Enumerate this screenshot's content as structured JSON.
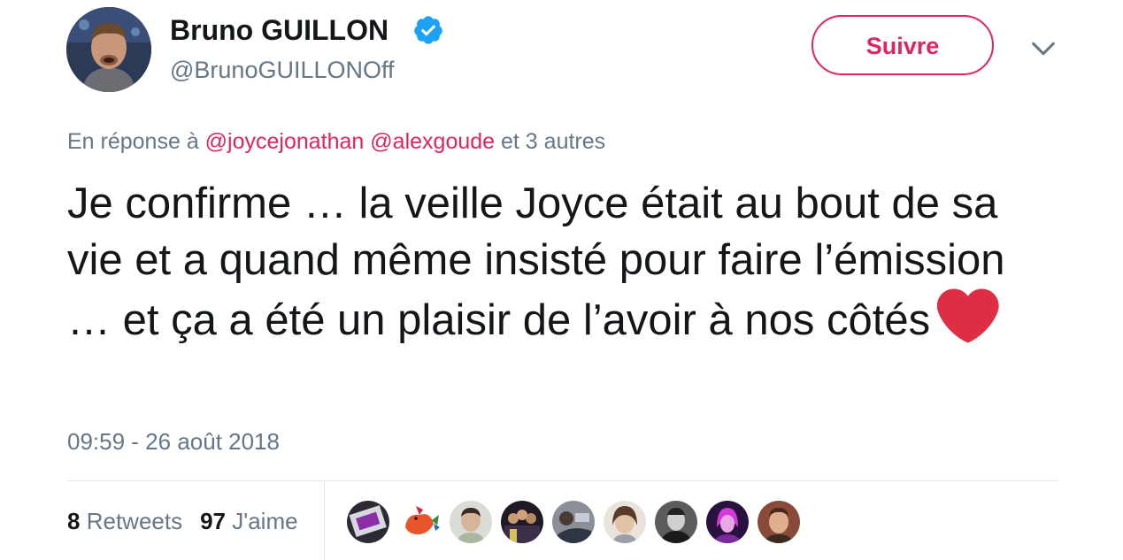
{
  "tweet": {
    "author": {
      "name": "Bruno GUILLON",
      "handle": "@BrunoGUILLONOff",
      "avatar_icon": "profile-photo",
      "verified_icon": "verified-badge-icon"
    },
    "follow_button_label": "Suivre",
    "menu_icon": "chevron-down-icon",
    "reply_context": {
      "prefix": "En réponse à",
      "mentions": [
        "@joycejonathan",
        "@alexgoude"
      ],
      "suffix": "et 3 autres"
    },
    "text": "Je confirme … la veille Joyce était au bout de sa vie et a quand même insisté pour faire l’émission … et ça a été un plaisir de l’avoir à nos côtés",
    "emoji": "red-heart",
    "timestamp": "09:59 - 26 août 2018",
    "stats": {
      "retweets_count": "8",
      "retweets_label": "Retweets",
      "likes_count": "97",
      "likes_label": "J'aime"
    },
    "likers": [
      "liker-avatar-1",
      "liker-avatar-2",
      "liker-avatar-3",
      "liker-avatar-4",
      "liker-avatar-5",
      "liker-avatar-6",
      "liker-avatar-7",
      "liker-avatar-8",
      "liker-avatar-9"
    ]
  },
  "colors": {
    "accent": "#e0245e",
    "secondary_text": "#657786",
    "primary_text": "#14171a",
    "verified": "#1da1f2",
    "divider": "#e1e8ed",
    "heart": "#dd2e44"
  }
}
